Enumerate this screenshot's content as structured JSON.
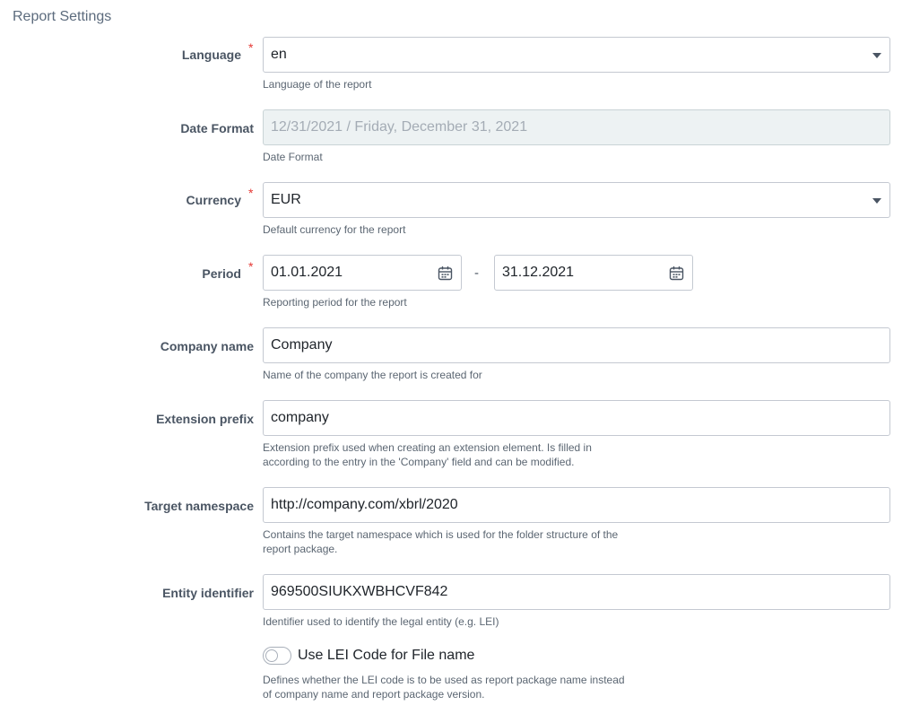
{
  "section_title": "Report Settings",
  "required_marker": "*",
  "language": {
    "label": "Language",
    "value": "en",
    "help": "Language of the report"
  },
  "date_format": {
    "label": "Date Format",
    "value": "12/31/2021 / Friday, December 31, 2021",
    "help": "Date Format"
  },
  "currency": {
    "label": "Currency",
    "value": "EUR",
    "help": "Default currency for the report"
  },
  "period": {
    "label": "Period",
    "start": "01.01.2021",
    "separator": "-",
    "end": "31.12.2021",
    "help": "Reporting period for the report"
  },
  "company_name": {
    "label": "Company name",
    "value": "Company",
    "help": "Name of the company the report is created for"
  },
  "extension_prefix": {
    "label": "Extension prefix",
    "value": "company",
    "help_line1": "Extension prefix used when creating an extension element. Is filled in",
    "help_line2": "according to the entry in the 'Company' field and can be modified."
  },
  "target_namespace": {
    "label": "Target namespace",
    "value": "http://company.com/xbrl/2020",
    "help_line1": "Contains the target namespace which is used for the folder structure of the",
    "help_line2": "report package."
  },
  "entity_identifier": {
    "label": "Entity identifier",
    "value": "969500SIUKXWBHCVF842",
    "help": "Identifier used to identify the legal entity (e.g. LEI)"
  },
  "lei_toggle": {
    "label": "Use LEI Code for File name",
    "checked": false,
    "help_line1": "Defines whether the LEI code is to be used as report package name instead",
    "help_line2": "of company name and report package version."
  },
  "colors": {
    "required": "#e53935",
    "label": "#4a5563",
    "border": "#c4c9d1",
    "disabled_bg": "#edf2f3"
  }
}
